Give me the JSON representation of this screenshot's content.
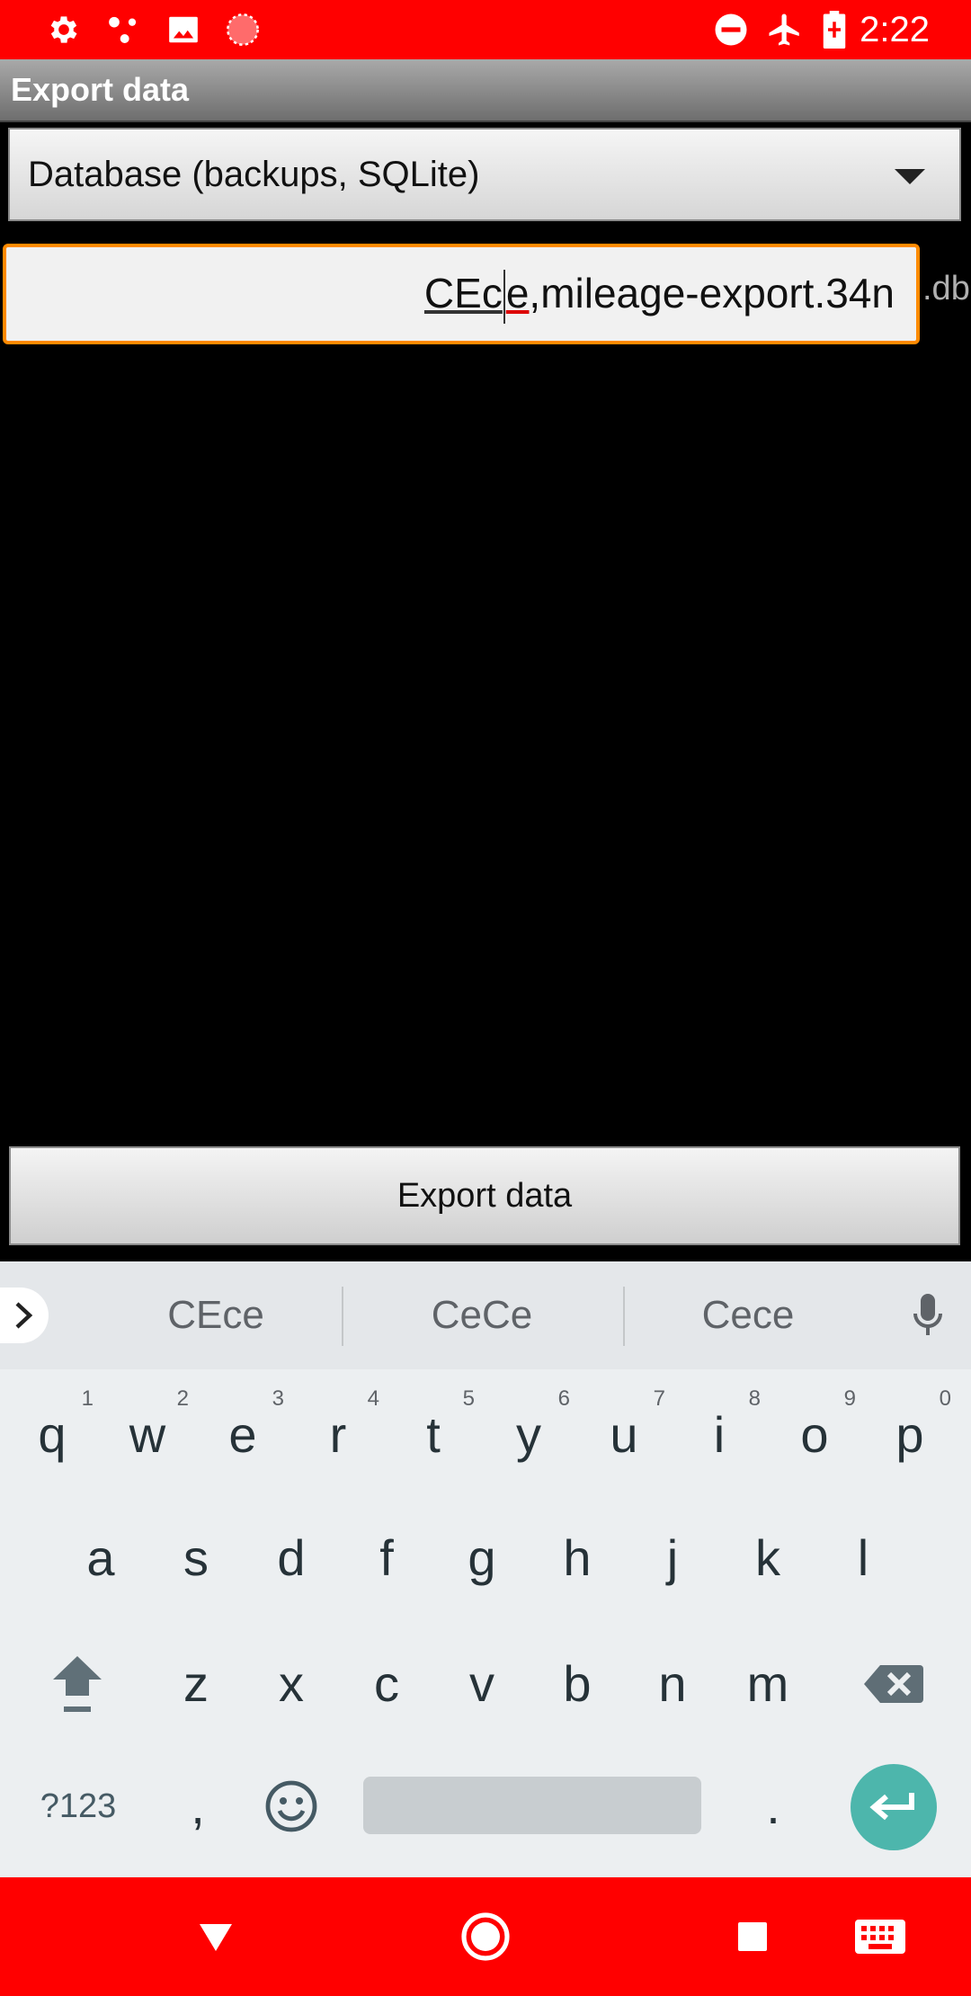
{
  "status_bar": {
    "time": "2:22",
    "left_icons": [
      "settings-icon",
      "connection-icon",
      "image-icon",
      "loading-icon"
    ],
    "right_icons": [
      "do-not-disturb-icon",
      "airplane-mode-icon",
      "battery-charging-icon"
    ]
  },
  "app": {
    "title": "Export data",
    "format_select": {
      "selected": "Database (backups, SQLite)"
    },
    "filename_field": {
      "composing_prefix": "CEc",
      "composing_suffix": "e",
      "value_rest": ",mileage-export.34n",
      "suffix": ".db"
    },
    "export_button": "Export data"
  },
  "keyboard": {
    "suggestions": [
      "CEce",
      "CeCe",
      "Cece"
    ],
    "row1": [
      {
        "key": "q",
        "hint": "1"
      },
      {
        "key": "w",
        "hint": "2"
      },
      {
        "key": "e",
        "hint": "3"
      },
      {
        "key": "r",
        "hint": "4"
      },
      {
        "key": "t",
        "hint": "5"
      },
      {
        "key": "y",
        "hint": "6"
      },
      {
        "key": "u",
        "hint": "7"
      },
      {
        "key": "i",
        "hint": "8"
      },
      {
        "key": "o",
        "hint": "9"
      },
      {
        "key": "p",
        "hint": "0"
      }
    ],
    "row2": [
      "a",
      "s",
      "d",
      "f",
      "g",
      "h",
      "j",
      "k",
      "l"
    ],
    "row3": [
      "z",
      "x",
      "c",
      "v",
      "b",
      "n",
      "m"
    ],
    "symbols_key": "?123",
    "comma_key": ",",
    "period_key": "."
  },
  "colors": {
    "status_bar": "#ff0000",
    "nav_bar": "#ff0000",
    "focus_border": "#ff8a00",
    "enter_key": "#4db6ac"
  }
}
